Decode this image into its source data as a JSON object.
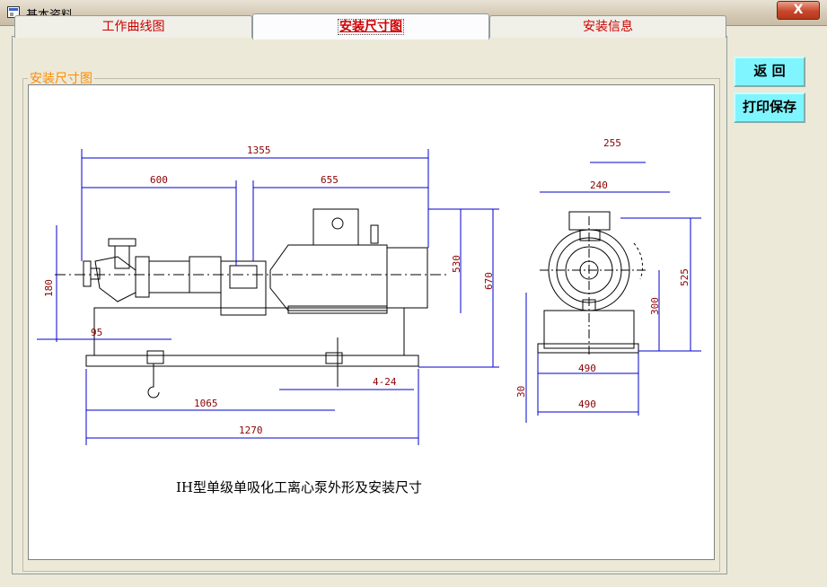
{
  "window": {
    "title": "基本资料",
    "close_label": "X"
  },
  "tabs": [
    {
      "label": "工作曲线图",
      "active": false
    },
    {
      "label": "安装尺寸图",
      "active": true
    },
    {
      "label": "安装信息",
      "active": false
    }
  ],
  "group_label": "安装尺寸图",
  "buttons": {
    "back": "返  回",
    "print_save": "打印保存"
  },
  "drawing": {
    "caption": "IH型单级单吸化工离心泵外形及安装尺寸",
    "dims": {
      "d1355": "1355",
      "d600": "600",
      "d655": "655",
      "d530": "530",
      "d670": "670",
      "d180": "180",
      "d95": "95",
      "d1065": "1065",
      "d1270": "1270",
      "d424": "4-24",
      "d255": "255",
      "d240": "240",
      "d525": "525",
      "d300": "300",
      "d30": "30",
      "d490a": "490",
      "d490b": "490"
    }
  },
  "colors": {
    "dimension_line": "#0000cc",
    "dimension_text": "#8b0000",
    "tab_text": "#cc0000",
    "group_label": "#ff8c00",
    "button_bg": "#7ff5ff"
  }
}
